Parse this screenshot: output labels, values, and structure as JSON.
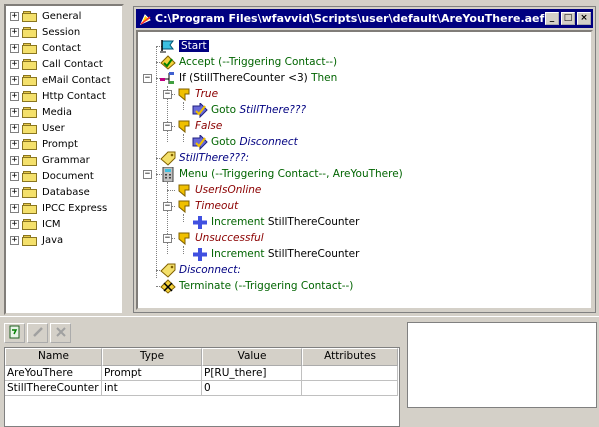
{
  "palette": {
    "items": [
      "General",
      "Session",
      "Contact",
      "Call Contact",
      "eMail Contact",
      "Http Contact",
      "Media",
      "User",
      "Prompt",
      "Grammar",
      "Document",
      "Database",
      "IPCC Express",
      "ICM",
      "Java"
    ],
    "expander": "+"
  },
  "window": {
    "title": "C:\\Program Files\\wfavvid\\Scripts\\user\\default\\AreYouThere.aef",
    "buttons": {
      "minimize": "_",
      "maximize": "□",
      "close": "×"
    }
  },
  "script": {
    "start": "Start",
    "accept": "Accept (--Triggering Contact--)",
    "if_kw": "If",
    "if_cond": "(StillThereCounter <3)",
    "if_then": "Then",
    "true_label": "True",
    "goto1_kw": "Goto",
    "goto1_target": "StillThere???",
    "false_label": "False",
    "goto2_kw": "Goto",
    "goto2_target": "Disconnect",
    "label_stillthere": "StillThere???:",
    "menu": "Menu (--Triggering Contact--, AreYouThere)",
    "user_online": "UserIsOnline",
    "timeout": "Timeout",
    "inc1_kw": "Increment",
    "inc1_var": "StillThereCounter",
    "unsuccessful": "Unsuccessful",
    "inc2_kw": "Increment",
    "inc2_var": "StillThereCounter",
    "label_disconnect": "Disconnect:",
    "terminate": "Terminate (--Triggering Contact--)",
    "expander_minus": "−"
  },
  "variables": {
    "columns": [
      "Name",
      "Type",
      "Value",
      "Attributes"
    ],
    "rows": [
      {
        "name": "AreYouThere",
        "type": "Prompt",
        "value": "P[RU_there]",
        "attributes": ""
      },
      {
        "name": "StillThereCounter",
        "type": "int",
        "value": "0",
        "attributes": ""
      }
    ],
    "toolbar": {
      "add": "add-variable",
      "edit": "edit-variable",
      "delete": "delete-variable"
    }
  },
  "colors": {
    "title_bg": "#000080",
    "folder": "#f4e06b",
    "step_text": "#006400",
    "branch_text": "#8b0000",
    "label_text": "#000080"
  }
}
